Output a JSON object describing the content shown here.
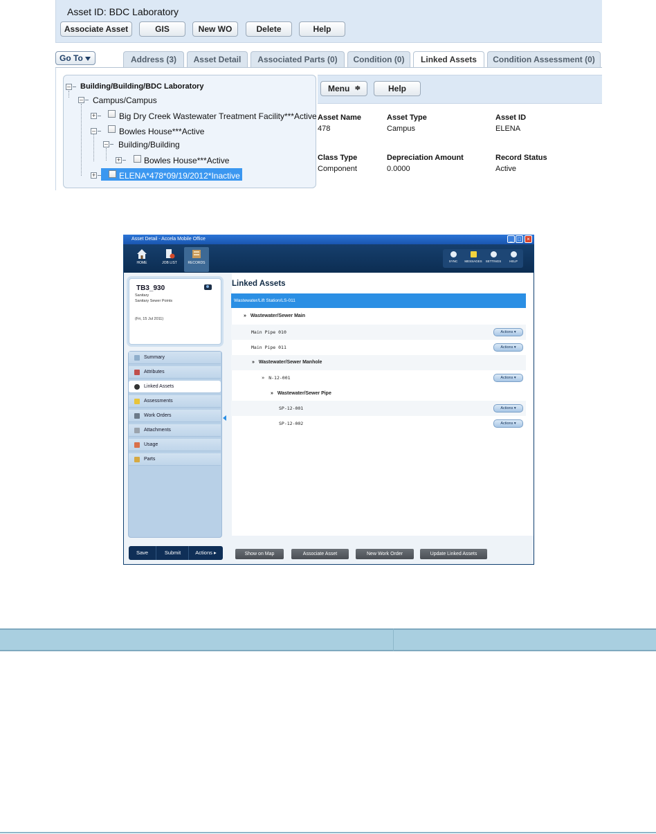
{
  "web": {
    "title": "Asset ID: BDC Laboratory",
    "buttons": [
      "Associate Asset",
      "GIS",
      "New WO",
      "Delete",
      "Help"
    ],
    "goto_label": "Go To",
    "tabs": [
      "Address (3)",
      "Asset Detail",
      "Associated Parts (0)",
      "Condition (0)",
      "Linked Assets",
      "Condition Assessment (0)"
    ],
    "active_tab": "Linked Assets",
    "tree": {
      "root": "Building/Building/BDC Laboratory",
      "campus": "Campus/Campus",
      "item1": "Big Dry Creek Wastewater Treatment Facility***Active",
      "item2": "Bowles House***Active",
      "building": "Building/Building",
      "item3": "Bowles House***Active",
      "item4": "ELENA*478*09/19/2012*Inactive"
    },
    "menu_label": "Menu",
    "help_label": "Help",
    "fields": {
      "asset_name_label": "Asset Name",
      "asset_name_value": "478",
      "asset_type_label": "Asset Type",
      "asset_type_value": "Campus",
      "asset_id_label": "Asset ID",
      "asset_id_value": "ELENA",
      "class_type_label": "Class Type",
      "class_type_value": "Component",
      "depreciation_label": "Depreciation Amount",
      "depreciation_value": "0.0000",
      "record_status_label": "Record Status",
      "record_status_value": "Active"
    }
  },
  "app": {
    "window_title": "Asset Detail - Accela Mobile Office",
    "nav": [
      "HOME",
      "JOB LIST",
      "RECORDS"
    ],
    "right_nav": [
      "SYNC",
      "MESSAGES",
      "SETTINGS",
      "HELP"
    ],
    "card": {
      "title": "TB3_930",
      "line1": "Sanitary",
      "line2": "Sanitary Sewer Points",
      "date": "(Fri, 15 Jul 2011)"
    },
    "sidebar": [
      "Summary",
      "Attributes",
      "Linked Assets",
      "Assessments",
      "Work Orders",
      "Attachments",
      "Usage",
      "Parts"
    ],
    "bottom_buttons": [
      "Save",
      "Submit",
      "Actions"
    ],
    "main_title": "Linked Assets",
    "path": "Wastewater/Lift Station/LS-011",
    "rows": {
      "g1": "Wastewater/Sewer Main",
      "r1": "Main Pipe 010",
      "r2": "Main Pipe 011",
      "g2": "Wastewater/Sewer Manhole",
      "r3": "N-12-001",
      "g3": "Wastewater/Sewer Pipe",
      "r4": "SP-12-001",
      "r5": "SP-12-002"
    },
    "actions_label": "Actions",
    "footer_buttons": [
      "Show on Map",
      "Associate Asset",
      "New Work Order",
      "Update Linked Assets"
    ]
  },
  "colors": {
    "accent": "#2b8fe4",
    "nav": "#0e3e6f",
    "header_bg": "#dce8f5",
    "table_head": "#a9cfe0"
  }
}
